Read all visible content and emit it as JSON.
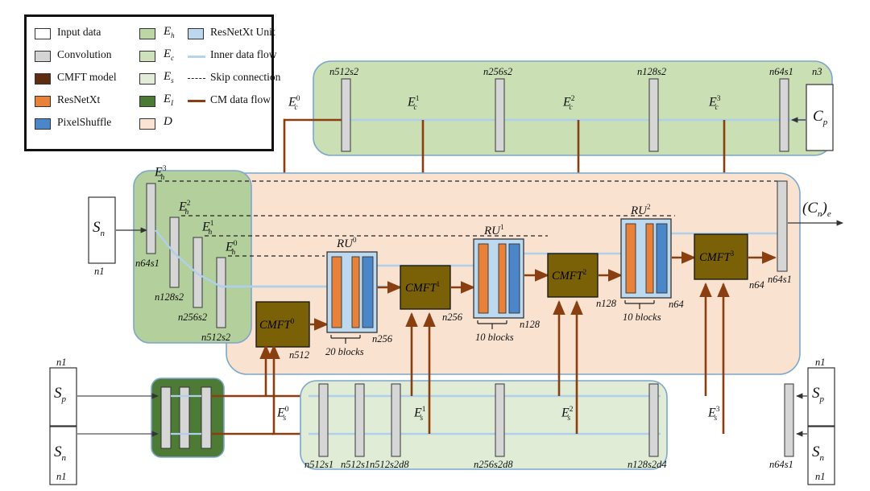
{
  "legend": {
    "items_col1": [
      {
        "label": "Input data",
        "color": "#ffffff"
      },
      {
        "label": "Convolution",
        "color": "#d4d4d4"
      },
      {
        "label": "CMFT model",
        "color": "#5c2d10"
      },
      {
        "label": "ResNetXt",
        "color": "#e8813a"
      },
      {
        "label": "PixelShuffle",
        "color": "#4a86c8"
      }
    ],
    "items_col2": [
      {
        "label": "E_h",
        "base": "E",
        "sub": "h",
        "color": "#bdd6a5"
      },
      {
        "label": "E_c",
        "base": "E",
        "sub": "c",
        "color": "#cfe0bc"
      },
      {
        "label": "E_s",
        "base": "E",
        "sub": "s",
        "color": "#e3ecd9"
      },
      {
        "label": "E_I",
        "base": "E",
        "sub": "I",
        "color": "#4a7a34"
      },
      {
        "label": "D",
        "base": "D",
        "sub": "",
        "color": "#fae3d3"
      }
    ],
    "items_col3": [
      {
        "label": "ResNetXt Unit",
        "kind": "swatch",
        "color": "#bcd7ee"
      },
      {
        "label": "Inner data flow",
        "kind": "line",
        "color": "#b7d4ea"
      },
      {
        "label": "Skip connection",
        "kind": "dashed",
        "color": "#222222"
      },
      {
        "label": "CM data flow",
        "kind": "line",
        "color": "#8a3f10"
      }
    ]
  },
  "panels": {
    "ec_panel": "E_c",
    "eh_panel": "E_h",
    "es_panel": "E_s",
    "ei_panel": "E_I",
    "d_panel": "D"
  },
  "ec_branch": {
    "convs": [
      "n512s2",
      "n256s2",
      "n128s2",
      "n64s1"
    ],
    "input": {
      "label": "C_p",
      "base": "C",
      "sub": "p",
      "size": "n3"
    },
    "taps": [
      {
        "base": "E",
        "sub": "c",
        "sup": "0"
      },
      {
        "base": "E",
        "sub": "c",
        "sup": "1"
      },
      {
        "base": "E",
        "sub": "c",
        "sup": "2"
      },
      {
        "base": "E",
        "sub": "c",
        "sup": "3"
      }
    ]
  },
  "eh_branch": {
    "input": {
      "base": "S",
      "sub": "n",
      "size": "n1"
    },
    "convs": [
      "n64s1",
      "n128s2",
      "n256s2",
      "n512s2"
    ],
    "taps": [
      {
        "base": "E",
        "sub": "h",
        "sup": "3"
      },
      {
        "base": "E",
        "sub": "h",
        "sup": "2"
      },
      {
        "base": "E",
        "sub": "h",
        "sup": "1"
      },
      {
        "base": "E",
        "sub": "h",
        "sup": "0"
      }
    ]
  },
  "ei_branch": {
    "inputs": [
      {
        "base": "S",
        "sub": "p",
        "size": "n1"
      },
      {
        "base": "S",
        "sub": "n",
        "size": "n1"
      }
    ]
  },
  "es_branch": {
    "convs": [
      "n512s1",
      "n512s1",
      "n512s2d8",
      "n256s2d8",
      "n128s2d4",
      "n64s1"
    ],
    "inputs": [
      {
        "base": "S",
        "sub": "p",
        "size": "n1"
      },
      {
        "base": "S",
        "sub": "n",
        "size": "n1"
      }
    ],
    "taps": [
      {
        "base": "E",
        "sub": "s",
        "sup": "0"
      },
      {
        "base": "E",
        "sub": "s",
        "sup": "1"
      },
      {
        "base": "E",
        "sub": "s",
        "sup": "2"
      },
      {
        "base": "E",
        "sub": "s",
        "sup": "3"
      }
    ]
  },
  "decoder": {
    "cmfts": [
      {
        "base": "CMFT",
        "sup": "0",
        "out": "n512"
      },
      {
        "base": "CMFT",
        "sup": "1",
        "out": "n256"
      },
      {
        "base": "CMFT",
        "sup": "2",
        "out": "n128"
      },
      {
        "base": "CMFT",
        "sup": "3",
        "out": "n64"
      }
    ],
    "rus": [
      {
        "base": "RU",
        "sup": "0",
        "blocks": "20 blocks",
        "out": "n256"
      },
      {
        "base": "RU",
        "sup": "1",
        "blocks": "10 blocks",
        "out": "n128"
      },
      {
        "base": "RU",
        "sup": "2",
        "blocks": "10 blocks",
        "out": "n64"
      }
    ],
    "final_conv": "n64s1",
    "output": {
      "base": "(C",
      "sub": "n",
      "suffix": ")",
      "sub2": "e"
    }
  },
  "colors": {
    "eh_green": "#b3cf9b",
    "ec_green": "#cadfb3",
    "es_green": "#e1ecd6",
    "ei_green": "#4d7b36",
    "d_peach": "#fae2d1",
    "conv_gray": "#d6d6d6",
    "cmft_brown": "#7a6108",
    "resnext_orange": "#e8813a",
    "pixelshuffle_blue": "#4a86c8",
    "ru_blue": "#bdd9f0",
    "flow_blue": "#aed0ea",
    "cm_brown": "#8a3f10",
    "panel_border": "#7ba7cd"
  }
}
